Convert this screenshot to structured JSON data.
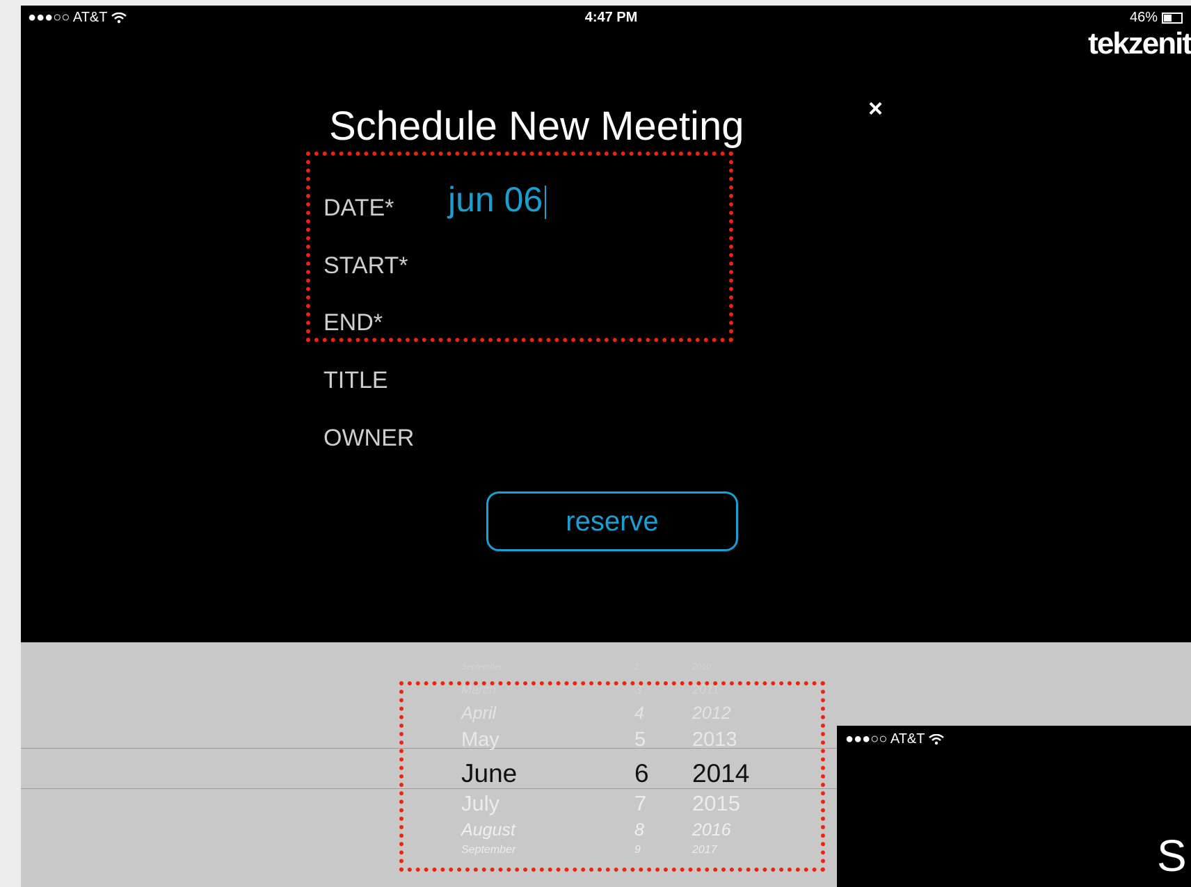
{
  "status": {
    "carrier": "●●●○○ AT&T",
    "time": "4:47 PM",
    "battery": "46%"
  },
  "brand": "tekzenit",
  "form": {
    "title": "Schedule New Meeting",
    "close": "×",
    "fields": [
      {
        "label": "DATE*",
        "value": "jun 06"
      },
      {
        "label": "START*",
        "value": ""
      },
      {
        "label": "END*",
        "value": ""
      },
      {
        "label": "TITLE",
        "value": ""
      },
      {
        "label": "OWNER",
        "value": ""
      }
    ],
    "reserve": "reserve"
  },
  "picker": {
    "rows": [
      {
        "month": "September",
        "day": "2",
        "year": "2010"
      },
      {
        "month": "March",
        "day": "3",
        "year": "2011"
      },
      {
        "month": "April",
        "day": "4",
        "year": "2012"
      },
      {
        "month": "May",
        "day": "5",
        "year": "2013"
      },
      {
        "month": "June",
        "day": "6",
        "year": "2014"
      },
      {
        "month": "July",
        "day": "7",
        "year": "2015"
      },
      {
        "month": "August",
        "day": "8",
        "year": "2016"
      },
      {
        "month": "September",
        "day": "9",
        "year": "2017"
      }
    ],
    "selected_index": 4
  },
  "mini_screen": {
    "carrier": "●●●○○ AT&T",
    "letter": "S"
  },
  "colors": {
    "accent": "#1a9fd2",
    "highlight": "#f2220e"
  }
}
